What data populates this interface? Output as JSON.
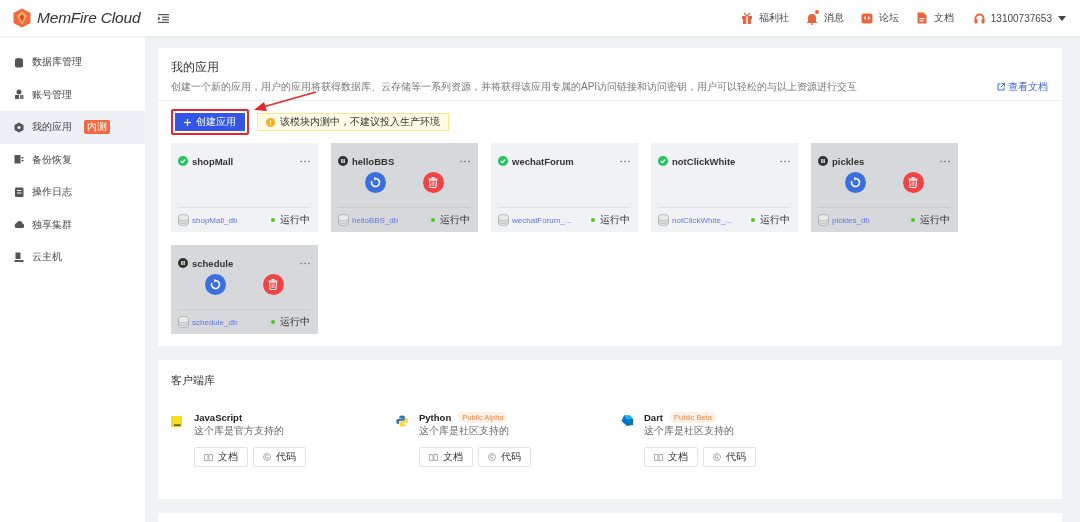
{
  "brand": {
    "name": "MemFire Cloud"
  },
  "sidebar": {
    "items": [
      {
        "label": "数据库管理",
        "selected": false
      },
      {
        "label": "账号管理",
        "selected": false
      },
      {
        "label": "我的应用",
        "selected": true,
        "badge": "内测"
      },
      {
        "label": "备份恢复",
        "selected": false
      },
      {
        "label": "操作日志",
        "selected": false
      },
      {
        "label": "独享集群",
        "selected": false
      },
      {
        "label": "云主机",
        "selected": false
      }
    ]
  },
  "header": {
    "items": [
      {
        "label": "福利社",
        "dot": false
      },
      {
        "label": "消息",
        "dot": true
      },
      {
        "label": "论坛",
        "dot": false
      },
      {
        "label": "文档",
        "dot": false
      }
    ],
    "user": "13100737653"
  },
  "apps_panel": {
    "title": "我的应用",
    "description": "创建一个新的应用，用户的应用将获得数据库、云存储等一系列资源，并将获得该应用专属的API访问链接和访问密钥，用户可以轻松的与以上资源进行交互",
    "docs_link": "查看文档",
    "create_button": {
      "label": "创建应用",
      "highlighted": true
    },
    "notice": "该模块内测中，不建议投入生产环境",
    "apps": [
      {
        "name": "shopMall",
        "paused": false,
        "database": "shopMall_db",
        "state": "运行中"
      },
      {
        "name": "helloBBS",
        "paused": true,
        "database": "helloBBS_db",
        "state": "运行中"
      },
      {
        "name": "wechatForum",
        "paused": false,
        "database": "wechatForum_...",
        "state": "运行中"
      },
      {
        "name": "notClickWhite",
        "paused": false,
        "database": "notClickWhite_...",
        "state": "运行中"
      },
      {
        "name": "pickles",
        "paused": true,
        "database": "pickles_db",
        "state": "运行中"
      },
      {
        "name": "schedule",
        "paused": true,
        "database": "schedule_db",
        "state": "运行中"
      }
    ]
  },
  "libraries_panel": {
    "title": "客户端库",
    "libraries": [
      {
        "name": "JavaScript",
        "description": "这个库是官方支持的",
        "docs": "文档",
        "code": "代码"
      },
      {
        "name": "Python",
        "tag": "Public Alpha",
        "description": "这个库是社区支持的",
        "docs": "文档",
        "code": "代码"
      },
      {
        "name": "Dart",
        "tag": "Public Beta",
        "description": "这个库是社区支持的",
        "docs": "文档",
        "code": "代码"
      }
    ]
  }
}
